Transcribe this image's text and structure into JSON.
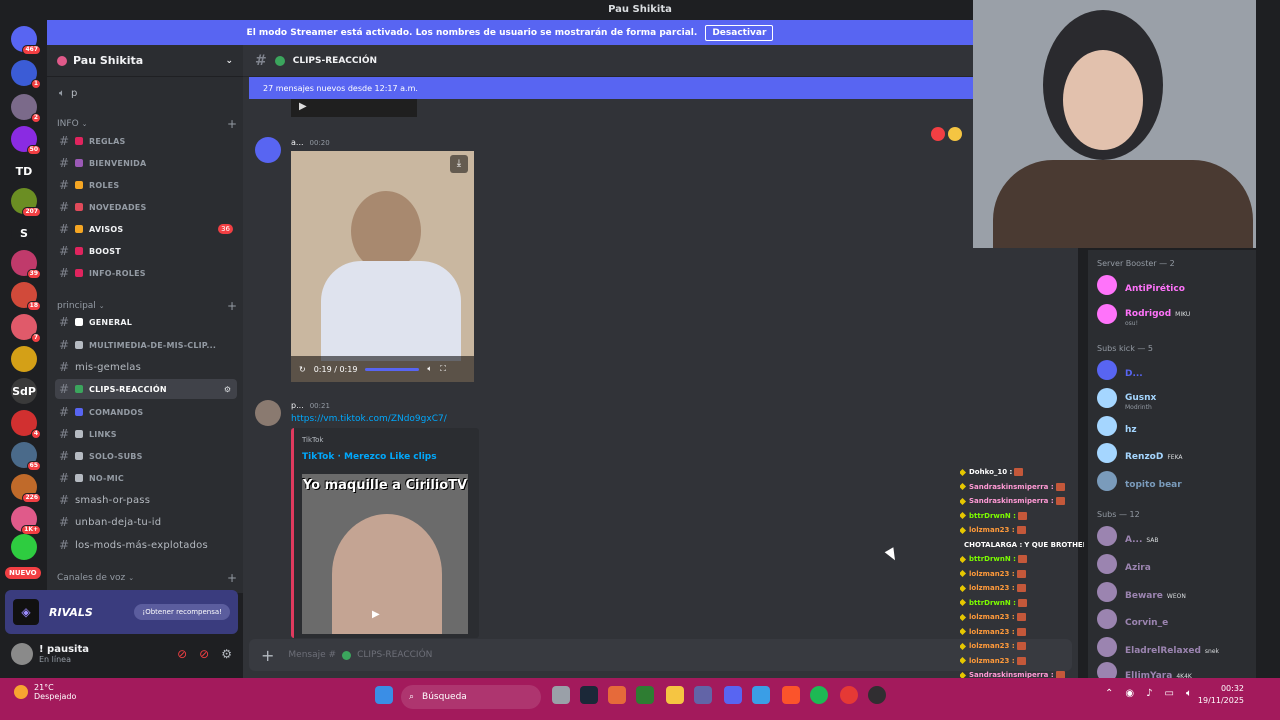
{
  "window": {
    "title": "Pau Shikita"
  },
  "streamer_banner": {
    "text": "El modo Streamer está activado. Los nombres de usuario se mostrarán de forma parcial.",
    "button": "Desactivar"
  },
  "servers": [
    {
      "label": "",
      "badge": "467",
      "color": "#5865f2"
    },
    {
      "label": "",
      "badge": "1",
      "color": "#3b5cd6"
    },
    {
      "label": "",
      "badge": "2",
      "color": "#7b6a8a"
    },
    {
      "label": "",
      "badge": "50",
      "color": "#8a2be2"
    },
    {
      "label": "TD",
      "badge": "",
      "color": "#1e1f22"
    },
    {
      "label": "",
      "badge": "207",
      "color": "#6b8e23"
    },
    {
      "label": "S",
      "badge": "",
      "color": "#1e1f22"
    },
    {
      "label": "",
      "badge": "39",
      "color": "#c03a6b"
    },
    {
      "label": "",
      "badge": "18",
      "color": "#d14a3a"
    },
    {
      "label": "",
      "badge": "7",
      "color": "#e05a6a"
    },
    {
      "label": "",
      "badge": "",
      "color": "#d4a017"
    },
    {
      "label": "SdP",
      "badge": "",
      "color": "#3a3a3a"
    },
    {
      "label": "",
      "badge": "4",
      "color": "#d13030"
    },
    {
      "label": "",
      "badge": "65",
      "color": "#4a6a8a"
    },
    {
      "label": "",
      "badge": "226",
      "color": "#c06a2a"
    },
    {
      "label": "",
      "badge": "1K+",
      "color": "#e05a8a"
    },
    {
      "label": "",
      "badge": "",
      "color": "#2ecc40"
    }
  ],
  "nuevo_label": "NUEVO",
  "guild": {
    "name": "Pau Shikita"
  },
  "sidebar": {
    "top_channel": "p",
    "categories": {
      "info": "INFO",
      "principal": "principal",
      "voice": "Canales de voz"
    },
    "channels": [
      {
        "label": "REGLAS",
        "color": "#e0245e",
        "style": "name"
      },
      {
        "label": "BIENVENIDA",
        "color": "#9b59b6",
        "style": "name"
      },
      {
        "label": "ROLES",
        "color": "#f5a623",
        "style": "name"
      },
      {
        "label": "NOVEDADES",
        "color": "#e04a5a",
        "style": "name"
      },
      {
        "label": "AVISOS",
        "color": "#f5a623",
        "style": "bright",
        "mention": "36"
      },
      {
        "label": "BOOST",
        "color": "#e0245e",
        "style": "bright"
      },
      {
        "label": "INFO-ROLES",
        "color": "#e0245e",
        "style": "name"
      },
      {
        "label": "GENERAL",
        "color": "#ffffff",
        "style": "bright"
      },
      {
        "label": "MULTIMEDIA-DE-MIS-CLIP...",
        "color": "#b5bac1",
        "style": "name"
      },
      {
        "label": "mis-gemelas",
        "color": "",
        "style": "plain"
      },
      {
        "label": "CLIPS-REACCIÓN",
        "color": "#3ba55d",
        "style": "active"
      },
      {
        "label": "COMANDOS",
        "color": "#5865f2",
        "style": "name"
      },
      {
        "label": "LINKS",
        "color": "#b5bac1",
        "style": "name"
      },
      {
        "label": "SOLO-SUBS",
        "color": "#b5bac1",
        "style": "name"
      },
      {
        "label": "NO-MIC",
        "color": "#b5bac1",
        "style": "name"
      },
      {
        "label": "smash-or-pass",
        "color": "",
        "style": "plain"
      },
      {
        "label": "unban-deja-tu-id",
        "color": "",
        "style": "plain"
      },
      {
        "label": "los-mods-más-explotados",
        "color": "",
        "style": "plain"
      }
    ]
  },
  "promo": {
    "brand": "RIVALS",
    "button": "¡Obtener recompensa!"
  },
  "user": {
    "name": "! pausita",
    "status": "En línea"
  },
  "channel_header": {
    "name": "CLIPS-REACCIÓN"
  },
  "new_messages": "27 mensajes nuevos desde 12:17 a.m.",
  "messages": [
    {
      "author": "a...",
      "time": "00:20",
      "video_time": "0:19 / 0:19"
    },
    {
      "author": "p...",
      "time": "00:21",
      "link": "https://vm.tiktok.com/ZNdo9gxC7/",
      "embed_provider": "TikTok",
      "embed_title": "TikTok · Merezco Like clips",
      "embed_text": "Yo maquille a CirilioTV"
    }
  ],
  "composer": {
    "placeholder": "Mensaje #",
    "channel": "CLIPS-REACCIÓN"
  },
  "chat": [
    {
      "user": "Dohko_10",
      "msg": "",
      "color": "#ffffff"
    },
    {
      "user": "Sandraskinsmiperra",
      "msg": "",
      "color": "#ff9ad5"
    },
    {
      "user": "Sandraskinsmiperra",
      "msg": "",
      "color": "#ff9ad5"
    },
    {
      "user": "bttrDrwnN",
      "msg": "",
      "color": "#7cfc00"
    },
    {
      "user": "lolzman23",
      "msg": "",
      "color": "#ff9a3a"
    },
    {
      "user": "CHOTALARGA",
      "msg": "Y QUE BROTHER",
      "color": "#ffffff"
    },
    {
      "user": "bttrDrwnN",
      "msg": "",
      "color": "#7cfc00"
    },
    {
      "user": "lolzman23",
      "msg": "",
      "color": "#ff9a3a"
    },
    {
      "user": "lolzman23",
      "msg": "",
      "color": "#ff9a3a"
    },
    {
      "user": "bttrDrwnN",
      "msg": "",
      "color": "#7cfc00"
    },
    {
      "user": "lolzman23",
      "msg": "",
      "color": "#ff9a3a"
    },
    {
      "user": "lolzman23",
      "msg": "",
      "color": "#ff9a3a"
    },
    {
      "user": "lolzman23",
      "msg": "",
      "color": "#ff9a3a"
    },
    {
      "user": "lolzman23",
      "msg": "",
      "color": "#ff9a3a"
    },
    {
      "user": "Sandraskinsmiperra",
      "msg": "",
      "color": "#ff9ad5"
    }
  ],
  "members": {
    "groups": {
      "booster": "Server Booster — 2",
      "subs_kick": "Subs kick — 5",
      "subs": "Subs — 12"
    },
    "booster": [
      {
        "name": "AntiPirético",
        "sub": "",
        "tag": "",
        "color": "#ff73fa"
      },
      {
        "name": "Rodrigod",
        "sub": "osu!",
        "tag": "MIKU",
        "color": "#ff73fa"
      }
    ],
    "subs_kick": [
      {
        "name": "D...",
        "sub": "",
        "tag": "",
        "color": "#5865f2"
      },
      {
        "name": "Gusnx",
        "sub": "Modrinth",
        "tag": "",
        "color": "#a5d6ff"
      },
      {
        "name": "hz",
        "sub": "",
        "tag": "",
        "color": "#a5d6ff"
      },
      {
        "name": "RenzoD",
        "sub": "",
        "tag": "FEKA",
        "color": "#a5d6ff"
      },
      {
        "name": "topito bear",
        "sub": "",
        "tag": "",
        "color": "#7a9bbb"
      }
    ],
    "subs": [
      {
        "name": "A...",
        "sub": "",
        "tag": "SAB",
        "color": "#9b84b0"
      },
      {
        "name": "Azira",
        "sub": "",
        "tag": "",
        "color": "#9b84b0"
      },
      {
        "name": "Beware",
        "sub": "",
        "tag": "WEON",
        "color": "#9b84b0"
      },
      {
        "name": "Corvin_e",
        "sub": "",
        "tag": "",
        "color": "#9b84b0"
      },
      {
        "name": "EladrelRelaxed",
        "sub": "",
        "tag": "snek",
        "color": "#9b84b0"
      },
      {
        "name": "ElJimYara",
        "sub": "",
        "tag": "4K4K",
        "color": "#9b84b0"
      }
    ]
  },
  "taskbar": {
    "weather_temp": "21°C",
    "weather_desc": "Despejado",
    "search": "Búsqueda",
    "time": "00:32",
    "date": "19/11/2025"
  }
}
